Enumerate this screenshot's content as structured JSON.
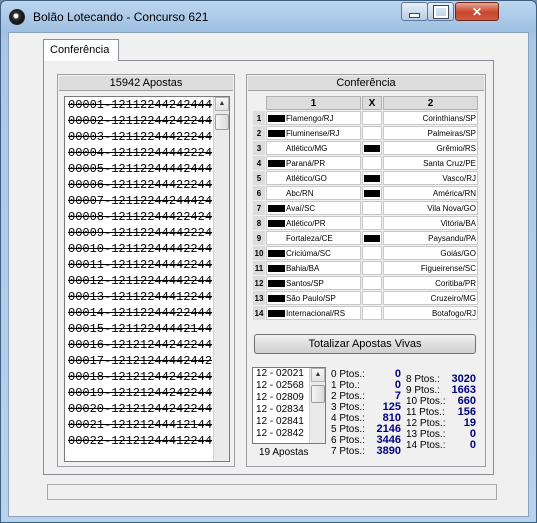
{
  "window": {
    "title": "Bolão Lotecando - Concurso 621"
  },
  "tab": {
    "label": "Conferência"
  },
  "bets_panel": {
    "header": "15942 Apostas",
    "rows": [
      "00001-12112244242444",
      "00002-12112244242244",
      "00003-12112244422244",
      "00004-12112244442224",
      "00005-12112244442444",
      "00006-12112244422244",
      "00007-12112244244424",
      "00008-12112244422424",
      "00009-12112244442224",
      "00010-12112244442244",
      "00011-12112244442244",
      "00012-12112244442244",
      "00013-12112244412244",
      "00014-12112244422444",
      "00015-12112244442144",
      "00016-12121244242244",
      "00017-12121244442442",
      "00018-12121244242244",
      "00019-12121244242244",
      "00020-12121244242244",
      "00021-12121244412144",
      "00022-12121244412244"
    ]
  },
  "conferencia_panel": {
    "header": "Conferência",
    "col_1": "1",
    "col_x": "X",
    "col_2": "2",
    "games": [
      {
        "n": "1",
        "team1": "Flamengo/RJ",
        "mark1": true,
        "markx": false,
        "team2": "Corinthians/SP"
      },
      {
        "n": "2",
        "team1": "Fluminense/RJ",
        "mark1": true,
        "markx": false,
        "team2": "Palmeiras/SP"
      },
      {
        "n": "3",
        "team1": "Atlético/MG",
        "mark1": false,
        "markx": true,
        "team2": "Grêmio/RS"
      },
      {
        "n": "4",
        "team1": "Paraná/PR",
        "mark1": true,
        "markx": false,
        "team2": "Santa Cruz/PE"
      },
      {
        "n": "5",
        "team1": "Atlético/GO",
        "mark1": false,
        "markx": true,
        "team2": "Vasco/RJ"
      },
      {
        "n": "6",
        "team1": "Abc/RN",
        "mark1": false,
        "markx": true,
        "team2": "América/RN"
      },
      {
        "n": "7",
        "team1": "Avaí/SC",
        "mark1": true,
        "markx": false,
        "team2": "Vila Nova/GO"
      },
      {
        "n": "8",
        "team1": "Atlético/PR",
        "mark1": true,
        "markx": false,
        "team2": "Vitória/BA"
      },
      {
        "n": "9",
        "team1": "Fortaleza/CE",
        "mark1": false,
        "markx": true,
        "team2": "Paysandu/PA"
      },
      {
        "n": "10",
        "team1": "Criciúma/SC",
        "mark1": true,
        "markx": false,
        "team2": "Goiás/GO"
      },
      {
        "n": "11",
        "team1": "Bahia/BA",
        "mark1": true,
        "markx": false,
        "team2": "Figueirense/SC"
      },
      {
        "n": "12",
        "team1": "Santos/SP",
        "mark1": true,
        "markx": false,
        "team2": "Coritiba/PR"
      },
      {
        "n": "13",
        "team1": "São Paulo/SP",
        "mark1": true,
        "markx": false,
        "team2": "Cruzeiro/MG"
      },
      {
        "n": "14",
        "team1": "Internacional/RS",
        "mark1": true,
        "markx": false,
        "team2": "Botafogo/RJ"
      }
    ],
    "totalize_button": "Totalizar Apostas Vivas",
    "live_list": [
      "12 - 02021",
      "12 - 02568",
      "12 - 02809",
      "12 - 02834",
      "12 - 02841",
      "12 - 02842"
    ],
    "live_count": "19 Apostas",
    "points_left": [
      {
        "label": "0 Ptos.:",
        "value": "0"
      },
      {
        "label": "1 Pto.:",
        "value": "0"
      },
      {
        "label": "2 Ptos.:",
        "value": "7"
      },
      {
        "label": "3 Ptos.:",
        "value": "125"
      },
      {
        "label": "4 Ptos.:",
        "value": "810"
      },
      {
        "label": "5 Ptos.:",
        "value": "2146"
      },
      {
        "label": "6 Ptos.:",
        "value": "3446"
      },
      {
        "label": "7 Ptos.:",
        "value": "3890"
      }
    ],
    "points_right": [
      {
        "label": "8 Ptos.:",
        "value": "3020"
      },
      {
        "label": "9 Ptos.:",
        "value": "1663"
      },
      {
        "label": "10 Ptos.:",
        "value": "660"
      },
      {
        "label": "11 Ptos.:",
        "value": "156"
      },
      {
        "label": "12 Ptos.:",
        "value": "19"
      },
      {
        "label": "13 Ptos.:",
        "value": "0"
      },
      {
        "label": "14 Ptos.:",
        "value": "0"
      }
    ]
  }
}
